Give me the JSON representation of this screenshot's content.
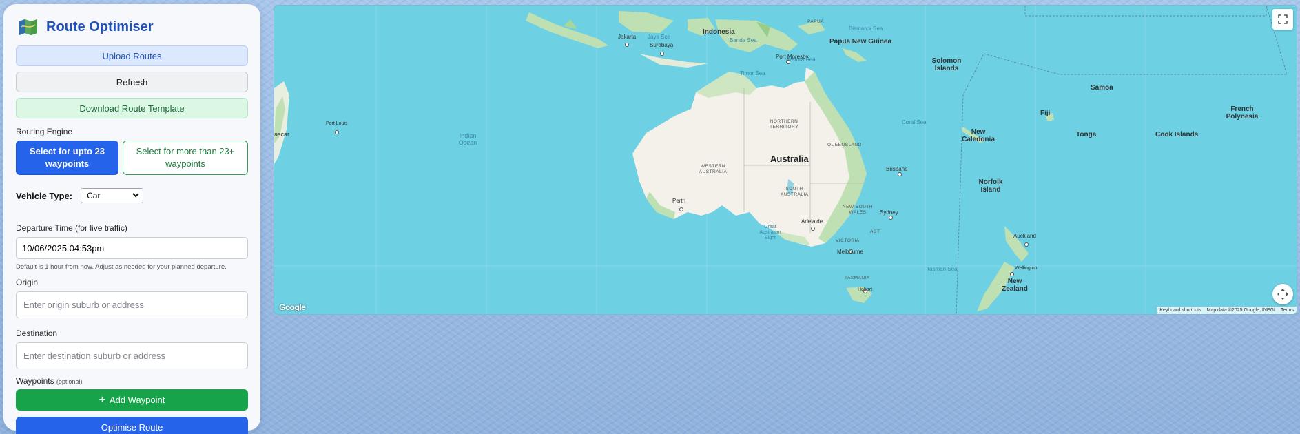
{
  "app": {
    "title": "Route Optimiser",
    "logo_icon": "map-icon"
  },
  "panel": {
    "upload_label": "Upload Routes",
    "refresh_label": "Refresh",
    "template_label": "Download Route Template",
    "routing_engine_label": "Routing Engine",
    "engine_options": [
      {
        "label": "Select for upto 23 waypoints",
        "selected": true
      },
      {
        "label": "Select for more than 23+ waypoints",
        "selected": false
      }
    ],
    "vehicle_label": "Vehicle Type:",
    "vehicle_value": "Car",
    "departure_label": "Departure Time (for live traffic)",
    "departure_value": "10/06/2025 04:53pm",
    "departure_hint": "Default is 1 hour from now. Adjust as needed for your planned departure.",
    "origin_label": "Origin",
    "origin_placeholder": "Enter origin suburb or address",
    "destination_label": "Destination",
    "destination_placeholder": "Enter destination suburb or address",
    "waypoints_label": "Waypoints",
    "waypoints_optional": "(optional)",
    "add_waypoint_label": "Add Waypoint",
    "optimise_label": "Optimise Route"
  },
  "map": {
    "labels": {
      "australia": "Australia",
      "indonesia": "Indonesia",
      "png": "Papua New Guinea",
      "solomon": "Solomon Islands",
      "samoa": "Samoa",
      "fiji": "Fiji",
      "tonga": "Tonga",
      "cook": "Cook Islands",
      "french_poly": "French Polynesia",
      "new_caledonia": "New Caledonia",
      "norfolk": "Norfolk Island",
      "new_zealand": "New Zealand",
      "madagascar": "ascar",
      "indian_ocean": "Indian Ocean",
      "coral_sea": "Coral Sea",
      "tasman_sea": "Tasman Sea",
      "timor_sea": "Timor Sea",
      "arafura_sea": "Arafura Sea",
      "java_sea": "Java Sea",
      "banda_sea": "Banda Sea",
      "bismarck_sea": "Bismarck Sea",
      "great_bight": "Great Australian Bight",
      "nt": "NORTHERN TERRITORY",
      "qld": "QUEENSLAND",
      "wa": "WESTERN AUSTRALIA",
      "sa": "SOUTH AUSTRALIA",
      "nsw": "NEW SOUTH WALES",
      "vic": "VICTORIA",
      "act": "ACT",
      "tas": "TASMANIA",
      "perth": "Perth",
      "adelaide": "Adelaide",
      "melbourne": "Melbourne",
      "sydney": "Sydney",
      "brisbane": "Brisbane",
      "hobart": "Hobart",
      "jakarta": "Jakarta",
      "surabaya": "Surabaya",
      "port_moresby": "Port Moresby",
      "port_louis": "Port Louis",
      "auckland": "Auckland",
      "wellington": "Wellington",
      "papua": "PAPUA"
    },
    "footer": {
      "shortcuts": "Keyboard shortcuts",
      "map_data": "Map data ©2025 Google, INEGI",
      "terms": "Terms"
    },
    "google_logo": "Google",
    "fullscreen_icon": "fullscreen-icon",
    "camera_icon": "camera-control-icon"
  },
  "colors": {
    "primary": "#2563eb",
    "success": "#16a34a",
    "ocean": "#6dd0e3",
    "land": "#f3f1ea",
    "vegetation": "#bfe0b3"
  }
}
